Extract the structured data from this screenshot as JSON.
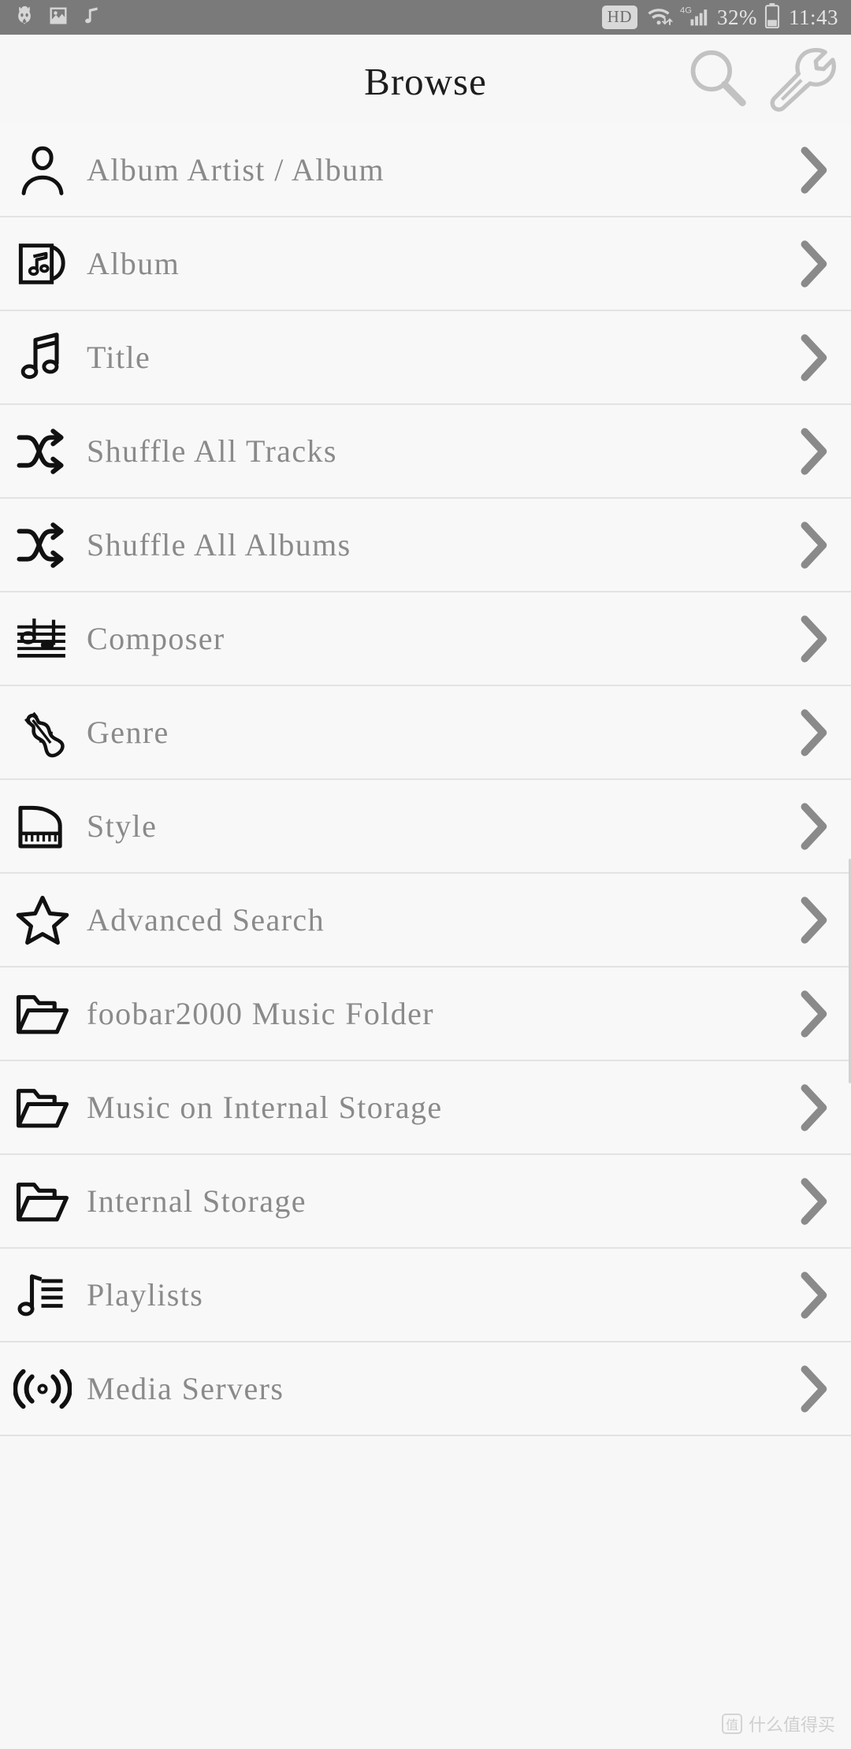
{
  "status_bar": {
    "left_icons": [
      {
        "name": "foobar2000-app-icon",
        "glyph": "cat"
      },
      {
        "name": "screenshot-icon",
        "glyph": "image"
      },
      {
        "name": "music-playing-icon",
        "glyph": "note"
      }
    ],
    "hd_label": "HD",
    "wifi_icon": "wifi-icon",
    "network_label": "4G",
    "signal_icon": "cellular-signal-icon",
    "battery_percent": "32%",
    "battery_icon": "battery-icon",
    "clock": "11:43"
  },
  "header": {
    "title": "Browse",
    "search_icon_label": "search-icon",
    "settings_icon_label": "wrench-icon"
  },
  "browse_list": {
    "items": [
      {
        "label": "Album Artist / Album",
        "icon": "person-icon"
      },
      {
        "label": "Album",
        "icon": "album-sleeve-icon"
      },
      {
        "label": "Title",
        "icon": "music-note-icon"
      },
      {
        "label": "Shuffle All Tracks",
        "icon": "shuffle-icon"
      },
      {
        "label": "Shuffle All Albums",
        "icon": "shuffle-icon"
      },
      {
        "label": "Composer",
        "icon": "music-staff-icon"
      },
      {
        "label": "Genre",
        "icon": "violin-icon"
      },
      {
        "label": "Style",
        "icon": "grand-piano-icon"
      },
      {
        "label": "Advanced Search",
        "icon": "star-icon"
      },
      {
        "label": "foobar2000 Music Folder",
        "icon": "folder-icon"
      },
      {
        "label": "Music on Internal Storage",
        "icon": "folder-icon"
      },
      {
        "label": "Internal Storage",
        "icon": "folder-icon"
      },
      {
        "label": "Playlists",
        "icon": "playlist-icon"
      },
      {
        "label": "Media Servers",
        "icon": "broadcast-icon"
      }
    ],
    "chevron_icon": "chevron-right-icon"
  },
  "watermark": {
    "badge": "值",
    "text": "什么值得买"
  },
  "colors": {
    "status_bar_bg": "#7a7a7a",
    "page_bg": "#f7f7f7",
    "row_bg": "#f8f8f8",
    "divider": "#e3e3e3",
    "label_text": "#8a8a8a",
    "title_text": "#1d1d1d",
    "icon_stroke": "#111111",
    "chevron": "#8a8a8a",
    "header_icon": "#c4c4c4"
  }
}
